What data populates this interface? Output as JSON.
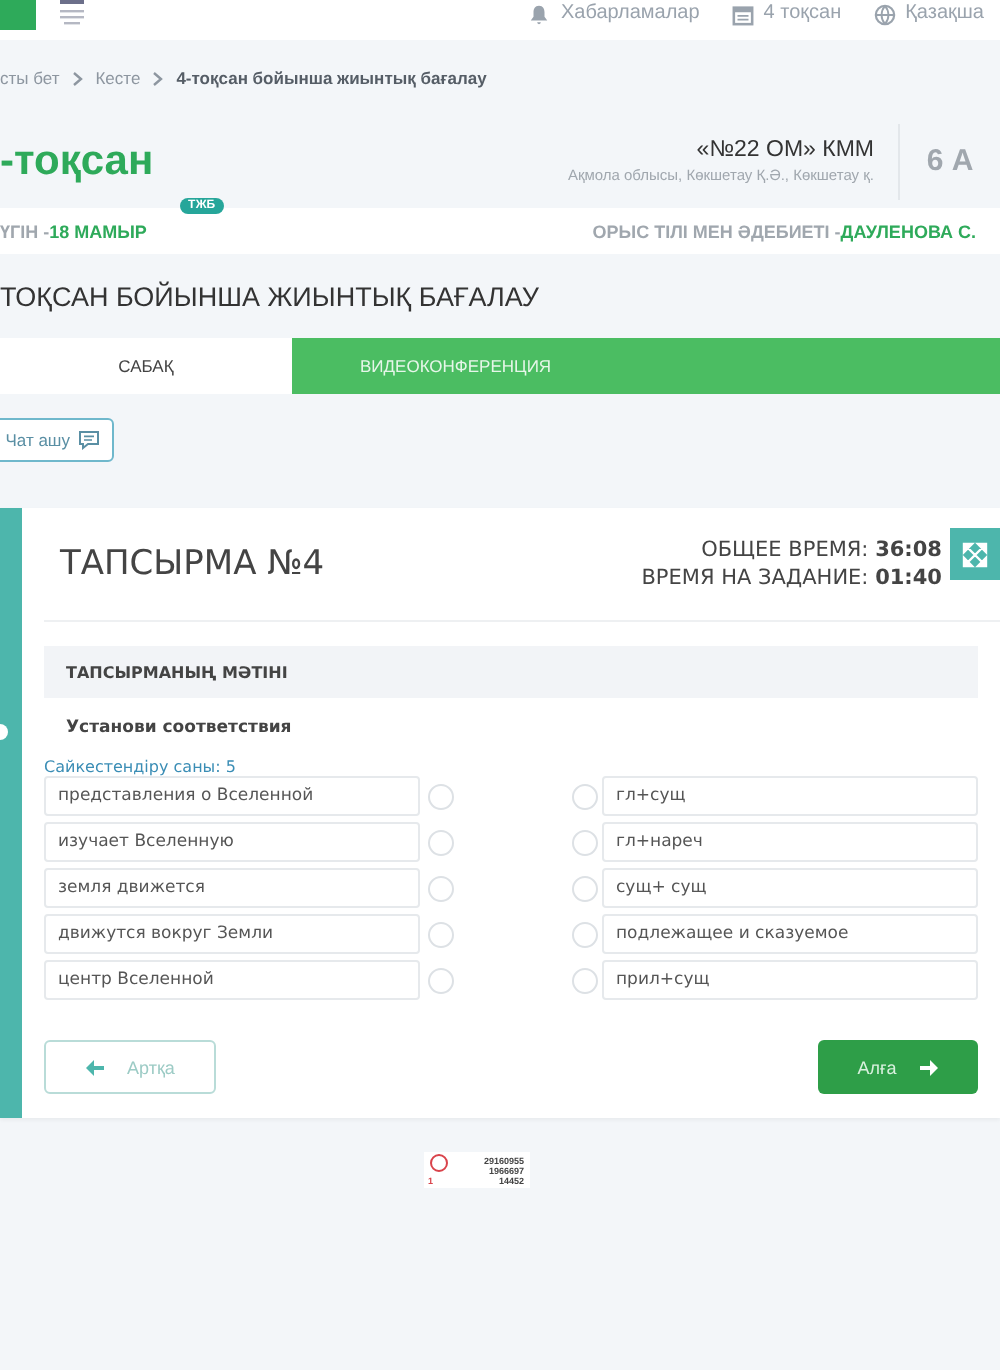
{
  "header": {
    "nav": [
      {
        "label": "Хабарламалар"
      },
      {
        "label": "4 тоқсан"
      },
      {
        "label": "Қазақша"
      }
    ]
  },
  "breadcrumb": [
    {
      "label": "сты бет",
      "current": false
    },
    {
      "label": "Кесте",
      "current": false
    },
    {
      "label": "4-тоқсан бойынша жиынтық бағалау",
      "current": true
    }
  ],
  "term": {
    "title": "-тоқсан",
    "school": "«№22 ОМ» КММ",
    "address": "Ақмола облысы, Көкшетау Қ.Ә., Көкшетау қ.",
    "class": "6 А"
  },
  "date_bar": {
    "label": "ҮГІН - ",
    "date": "18 МАМЫР",
    "badge": "ТЖБ",
    "subject": "ОРЫС ТІЛІ МЕН ӘДЕБИЕТІ - ",
    "teacher": "ДАУЛЕНОВА С."
  },
  "page_title": "ТОҚСАН БОЙЫНША ЖИЫНТЫҚ БАҒАЛАУ",
  "tabs": [
    {
      "label": "САБАҚ",
      "selected": true
    },
    {
      "label": "ВИДЕОКОНФЕРЕНЦИЯ",
      "selected": false
    }
  ],
  "chat_button": "Чат ашу",
  "task": {
    "title": "ТАПСЫРМА №4",
    "timers": [
      "ОБЩЕЕ ВРЕМЯ: **36:08**",
      "ВРЕМЯ НА ЗАДАНИЕ: **01:40**"
    ],
    "section_title": "ТАПСЫРМАНЫҢ МӘТІНІ",
    "instruction": "Установи соответствия",
    "match_count": "Сайкестендіру саны: 5",
    "pairs": [
      {
        "left": "представления о Вселенной",
        "left_selected": false,
        "right": "гл+сущ",
        "right_selected": false
      },
      {
        "left": "изучает Вселенную",
        "left_selected": false,
        "right": "гл+нареч",
        "right_selected": false
      },
      {
        "left": "земля движется",
        "left_selected": false,
        "right": "сущ+ сущ",
        "right_selected": false
      },
      {
        "left": "движутся вокруг Земли",
        "left_selected": false,
        "right": "подлежащее и сказуемое",
        "right_selected": false
      },
      {
        "left": "центр Вселенной",
        "left_selected": false,
        "right": "прил+сущ",
        "right_selected": false
      }
    ],
    "back": "Артқа",
    "next": "Алға"
  },
  "counter": [
    "29160955",
    "1966697",
    "1",
    "14452"
  ]
}
